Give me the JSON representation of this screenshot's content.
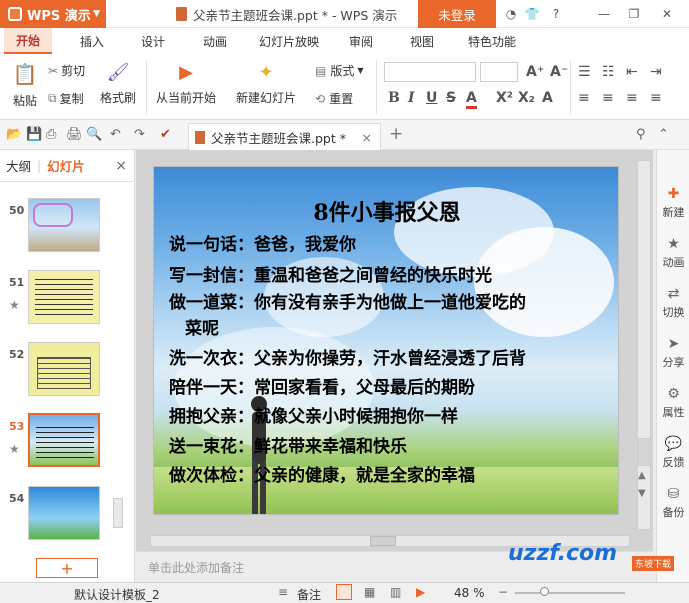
{
  "app": {
    "name": "WPS 演示",
    "doc_title": "父亲节主题班会课.ppt * - WPS 演示",
    "login": "未登录"
  },
  "window": {
    "icons": [
      "shirt-icon",
      "help-icon",
      "minimize-icon",
      "restore-icon",
      "close-icon"
    ],
    "help_label": "?",
    "min_label": "—",
    "restore_label": "❐",
    "close_label": "✕"
  },
  "menu": [
    "开始",
    "插入",
    "设计",
    "动画",
    "幻灯片放映",
    "审阅",
    "视图",
    "特色功能"
  ],
  "ribbon": {
    "paste": "粘贴",
    "cut": "剪切",
    "copy": "复制",
    "format_painter": "格式刷",
    "from_current": "从当前开始",
    "new_slide": "新建幻灯片",
    "layout": "版式",
    "reset": "重置"
  },
  "doctab": {
    "label": "父亲节主题班会课.ppt *",
    "close": "×"
  },
  "leftpanel": {
    "tab_outline": "大纲",
    "tab_slides": "幻灯片",
    "close": "×",
    "add": "+",
    "slides": [
      "50",
      "51",
      "52",
      "53",
      "54"
    ]
  },
  "slide": {
    "title": "8件小事报父恩",
    "lines": [
      "说一句话：爸爸，我爱你",
      "写一封信：重温和爸爸之间曾经的快乐时光",
      "做一道菜：你有没有亲手为他做上一道他爱吃的",
      "菜呢",
      "洗一次衣：父亲为你操劳，汗水曾经浸透了后背",
      "陪伴一天：常回家看看，父母最后的期盼",
      "拥抱父亲：就像父亲小时候拥抱你一样",
      "送一束花：鲜花带来幸福和快乐",
      "做次体检：父亲的健康，就是全家的幸福"
    ]
  },
  "notes_placeholder": "单击此处添加备注",
  "rightbar": [
    "新建",
    "动画",
    "切换",
    "分享",
    "属性",
    "反馈",
    "备份"
  ],
  "statusbar": {
    "template": "默认设计模板_2",
    "notes": "备注",
    "zoom": "48 %"
  },
  "watermark": {
    "main": "uzzf.com",
    "badge": "东坡下载"
  },
  "colors": {
    "accent": "#e9672b"
  }
}
